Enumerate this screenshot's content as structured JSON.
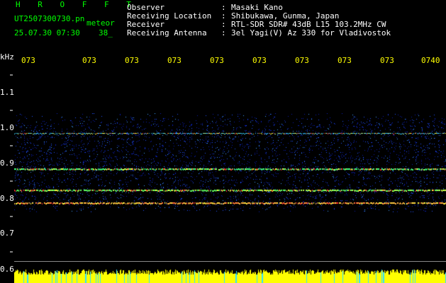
{
  "header": {
    "brand": "H R O F F T",
    "filename": "UT2507300730.pn",
    "meteor_label": "meteor",
    "datetime": "25.07.30 07:30",
    "count": "38_"
  },
  "meta": [
    {
      "label": "Observer",
      "value": "Masaki Kano"
    },
    {
      "label": "Receiving Location",
      "value": "Shibukawa, Gunma, Japan"
    },
    {
      "label": "Receiver",
      "value": "RTL-SDR SDR# 43dB L15 103.2MHz CW"
    },
    {
      "label": "Receiving Antenna",
      "value": "3el Yagi(V) Az 330 for Vladivostok"
    }
  ],
  "meta_separator": ":",
  "axis": {
    "unit": "kHz",
    "time_labels": [
      "073",
      "073",
      "073",
      "073",
      "073",
      "073",
      "073",
      "073",
      "073",
      "0740"
    ],
    "y_ticks": [
      "1.1",
      "1.0",
      "0.9",
      "0.8",
      "0.7",
      "0.6"
    ]
  },
  "colors": {
    "header_green": "#00ff00",
    "time_yellow": "#ffff00",
    "noise_blue": "#1a3cff",
    "level_yellow": "#ffff00",
    "baseline_gray": "#888888"
  }
}
